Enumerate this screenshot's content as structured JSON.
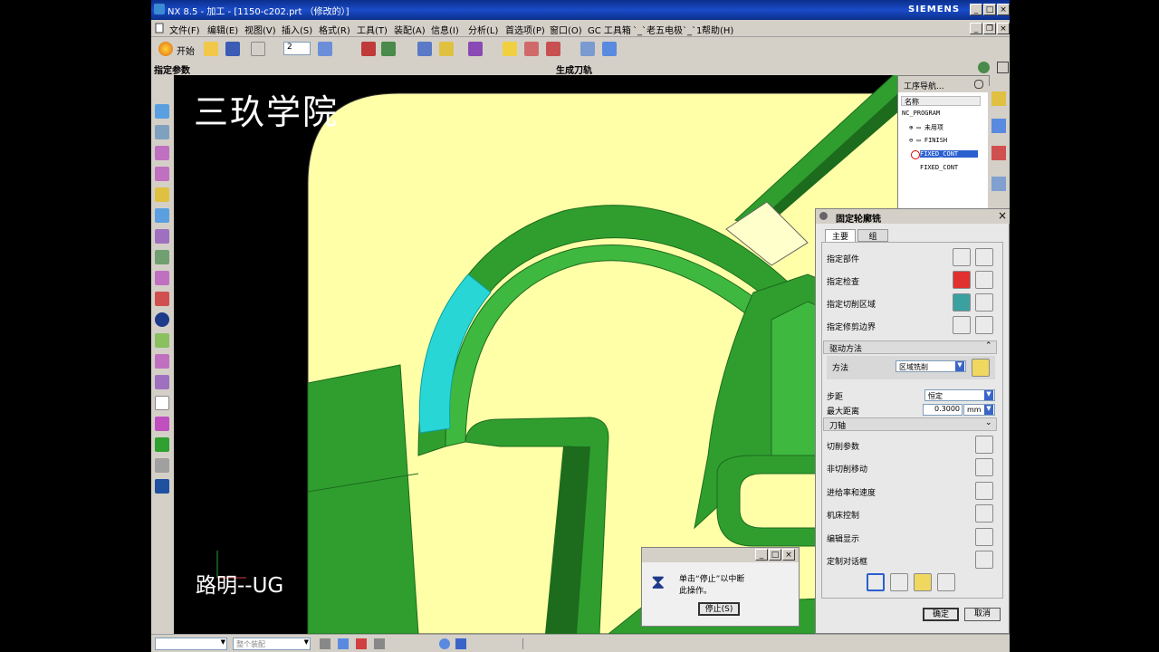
{
  "window": {
    "title": "NX 8.5 - 加工 - [1150-c202.prt （修改的）]",
    "brand": "SIEMENS",
    "min": "_",
    "max": "□",
    "close": "×"
  },
  "menu": [
    "文件(F)",
    "编辑(E)",
    "视图(V)",
    "插入(S)",
    "格式(R)",
    "工具(T)",
    "装配(A)",
    "信息(I)",
    "分析(L)",
    "首选项(P)",
    "窗口(O)",
    "GC 工具箱",
    "`_`老五电极`_`1",
    "帮助(H)"
  ],
  "toolbar": {
    "start_label": "开始",
    "layer_value": "2"
  },
  "status": {
    "left": "指定参数",
    "center": "生成刀轨"
  },
  "viewport": {
    "watermark": "三玖学院",
    "caption": "路明--UG"
  },
  "navigator": {
    "title": "工序导航...",
    "column": "名称",
    "rows": [
      "NC_PROGRAM",
      "未用项",
      "FINISH",
      "FIXED_CONT",
      "FIXED_CONT"
    ]
  },
  "dialog": {
    "title": "固定轮廓铣",
    "tabs": [
      "主要",
      "组"
    ],
    "rows": [
      "指定部件",
      "指定检查",
      "指定切削区域",
      "指定修剪边界"
    ],
    "drive_section": "驱动方法",
    "method_label": "方法",
    "method_value": "区域铣削",
    "stepover_label": "步距",
    "stepover_value": "恒定",
    "maxdist_label": "最大距离",
    "maxdist_value": "0.3000",
    "maxdist_unit": "mm",
    "toolaxis_section": "刀轴",
    "actions": [
      "切削参数",
      "非切削移动",
      "进给率和速度",
      "机床控制",
      "编辑显示",
      "定制对话框"
    ],
    "ok": "确定",
    "cancel": "取消"
  },
  "progress": {
    "message_line1": "单击“停止”以中断",
    "message_line2": "此操作。",
    "stop": "停止(S)"
  },
  "bottombar": {
    "filter": "整个装配"
  },
  "colors": {
    "part_green": "#2f9e2f",
    "part_dark": "#1d6b1d",
    "face_yellow": "#ffffa8",
    "toolpath_cyan": "#29d6d6",
    "titlebar": "#0b2f8c"
  }
}
